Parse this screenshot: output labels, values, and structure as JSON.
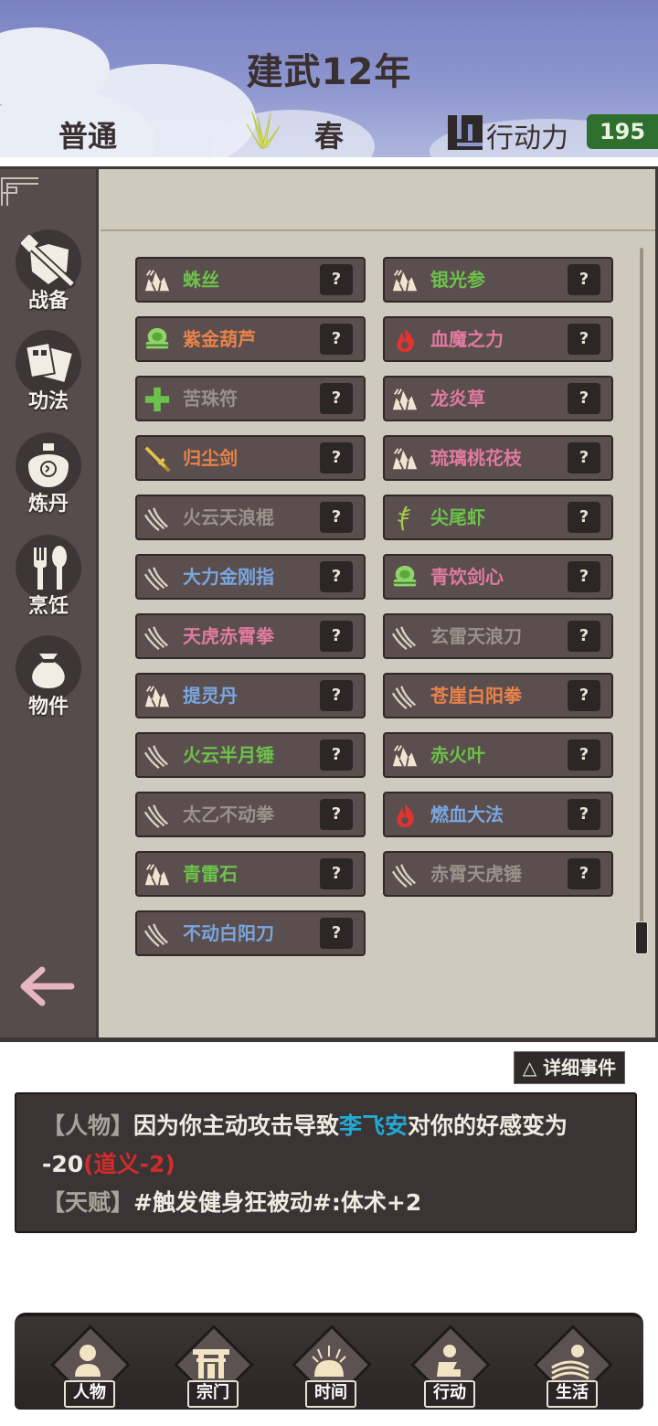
{
  "header": {
    "title": "建武12年",
    "mode": "普通",
    "season": "春",
    "action_label": "行动力",
    "action_value": "195",
    "season_icon": "grass-icon",
    "action_icon": "maze-icon"
  },
  "sidebar": {
    "items": [
      {
        "label": "战备",
        "icon": "sword-shield-icon"
      },
      {
        "label": "功法",
        "icon": "scroll-book-icon"
      },
      {
        "label": "炼丹",
        "icon": "cauldron-icon"
      },
      {
        "label": "烹饪",
        "icon": "fork-spoon-icon"
      },
      {
        "label": "物件",
        "icon": "pouch-icon"
      }
    ],
    "back_icon": "back-arrow-icon"
  },
  "items": [
    {
      "name": "蛛丝",
      "color": "#6cc24a",
      "icon": "ore"
    },
    {
      "name": "银光参",
      "color": "#6cc24a",
      "icon": "ore"
    },
    {
      "name": "紫金葫芦",
      "color": "#e8834a",
      "icon": "artifact"
    },
    {
      "name": "血魔之力",
      "color": "#e07aa0",
      "icon": "fire"
    },
    {
      "name": "苦珠符",
      "color": "#9a928a",
      "icon": "cross"
    },
    {
      "name": "龙炎草",
      "color": "#e07aa0",
      "icon": "ore"
    },
    {
      "name": "归尘剑",
      "color": "#e8834a",
      "icon": "sword"
    },
    {
      "name": "琉璃桃花枝",
      "color": "#e07aa0",
      "icon": "ore"
    },
    {
      "name": "火云天浪棍",
      "color": "#9a928a",
      "icon": "claw"
    },
    {
      "name": "尖尾虾",
      "color": "#6cc24a",
      "icon": "herb"
    },
    {
      "name": "大力金刚指",
      "color": "#7aa6e0",
      "icon": "claw"
    },
    {
      "name": "青饮剑心",
      "color": "#e07aa0",
      "icon": "artifact"
    },
    {
      "name": "天虎赤霄拳",
      "color": "#e07aa0",
      "icon": "claw"
    },
    {
      "name": "玄雷天浪刀",
      "color": "#9a928a",
      "icon": "claw"
    },
    {
      "name": "提灵丹",
      "color": "#7aa6e0",
      "icon": "ore"
    },
    {
      "name": "苍崖白阳拳",
      "color": "#e8834a",
      "icon": "claw"
    },
    {
      "name": "火云半月锤",
      "color": "#6cc24a",
      "icon": "claw"
    },
    {
      "name": "赤火叶",
      "color": "#6cc24a",
      "icon": "ore"
    },
    {
      "name": "太乙不动拳",
      "color": "#9a928a",
      "icon": "claw"
    },
    {
      "name": "燃血大法",
      "color": "#7aa6e0",
      "icon": "fire"
    },
    {
      "name": "青雷石",
      "color": "#6cc24a",
      "icon": "ore"
    },
    {
      "name": "赤霄天虎锤",
      "color": "#9a928a",
      "icon": "claw"
    },
    {
      "name": "不动白阳刀",
      "color": "#7aa6e0",
      "icon": "claw"
    }
  ],
  "item_q": "?",
  "events": {
    "detail_button": "△ 详细事件",
    "line1_tag": "【人物】",
    "line1_pre": "因为你主动攻击导致",
    "line1_name": "李飞安",
    "line1_post": "对你的好感变为",
    "line2_value": "-20",
    "line2_red": "(道义-2)",
    "line3_tag": "【天赋】",
    "line3_text": "#触发健身狂被动#:体术+2"
  },
  "bottom_nav": [
    {
      "label": "人物",
      "icon": "person-icon"
    },
    {
      "label": "宗门",
      "icon": "gate-icon"
    },
    {
      "label": "时间",
      "icon": "sun-icon"
    },
    {
      "label": "行动",
      "icon": "runner-icon"
    },
    {
      "label": "生活",
      "icon": "landscape-icon"
    }
  ]
}
